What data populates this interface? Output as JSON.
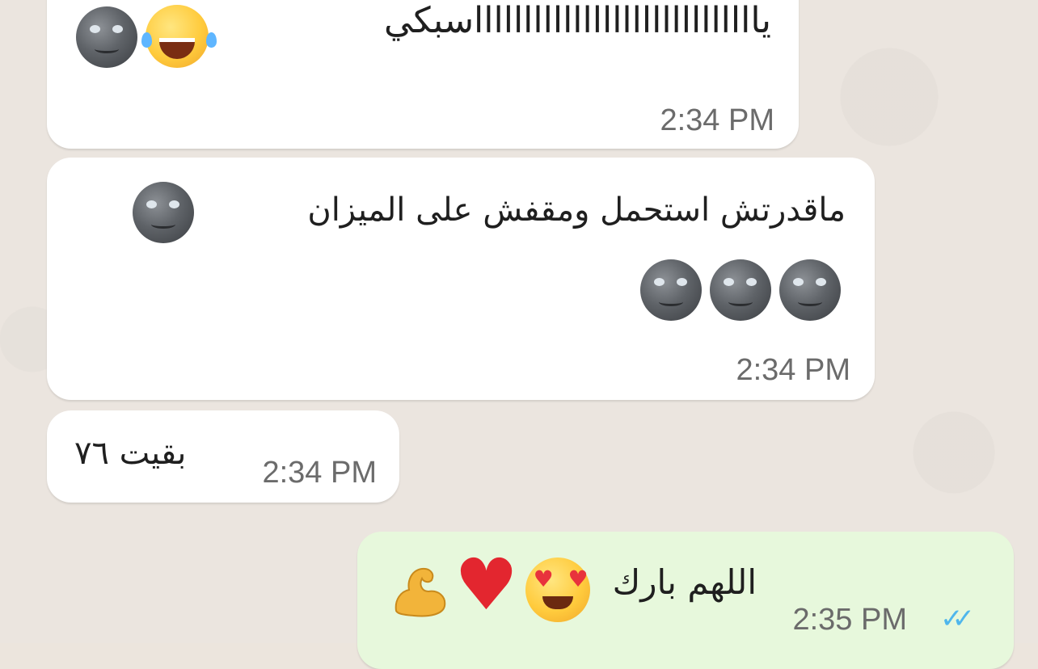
{
  "conversation": {
    "messages": [
      {
        "direction": "incoming",
        "text": "ياااااااااااااااااااااااااااااسبكي",
        "emojis": [
          "face-with-tears-of-joy",
          "new-moon-face"
        ],
        "time": "2:34 PM"
      },
      {
        "direction": "incoming",
        "text": "ماقدرتش استحمل ومقفش على الميزان",
        "emojis": [
          "new-moon-face",
          "new-moon-face",
          "new-moon-face",
          "new-moon-face"
        ],
        "time": "2:34 PM"
      },
      {
        "direction": "incoming",
        "text": "بقيت ٧٦",
        "time": "2:34 PM"
      },
      {
        "direction": "outgoing",
        "text": "اللهم بارك",
        "emojis": [
          "smiling-face-with-heart-eyes",
          "red-heart",
          "flexed-biceps"
        ],
        "time": "2:35 PM",
        "status": "read",
        "status_icon": "double-check-icon",
        "status_color": "#4fb6ec"
      }
    ]
  },
  "colors": {
    "incoming_bubble": "#ffffff",
    "outgoing_bubble": "#e7f8dc",
    "background": "#ebe5df",
    "timestamp": "#6b6b6b"
  }
}
